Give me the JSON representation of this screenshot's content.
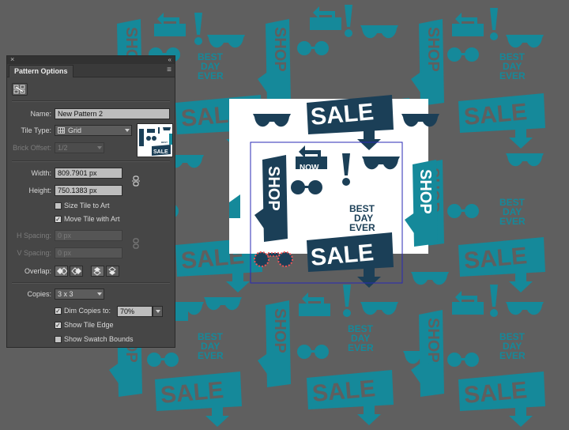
{
  "panel": {
    "tab_label": "Pattern Options",
    "close_glyph": "×",
    "collapse_glyph": "«",
    "menu_glyph": "≡",
    "name_label": "Name:",
    "name_value": "New Pattern 2",
    "tile_type_label": "Tile Type:",
    "tile_type_value": "Grid",
    "brick_offset_label": "Brick Offset:",
    "brick_offset_value": "1/2",
    "width_label": "Width:",
    "width_value": "809.7901 px",
    "height_label": "Height:",
    "height_value": "750.1383 px",
    "size_tile_to_art": {
      "label": "Size Tile to Art",
      "checked": false
    },
    "move_tile_with_art": {
      "label": "Move Tile with Art",
      "checked": true
    },
    "h_spacing_label": "H Spacing:",
    "h_spacing_value": "0 px",
    "v_spacing_label": "V Spacing:",
    "v_spacing_value": "0 px",
    "overlap_label": "Overlap:",
    "copies_label": "Copies:",
    "copies_value": "3 x 3",
    "dim_copies": {
      "label": "Dim Copies to:",
      "checked": true,
      "value": "70%"
    },
    "show_tile_edge": {
      "label": "Show Tile Edge",
      "checked": true
    },
    "show_swatch_bounds": {
      "label": "Show Swatch Bounds",
      "checked": false
    },
    "check_glyph": "✓"
  },
  "art": {
    "sale": "SALE",
    "shop": "SHOP",
    "now": "NOW",
    "best": "BEST",
    "day": "DAY",
    "ever": "EVER",
    "exclaim": "!"
  },
  "colors": {
    "teal": "#15899a",
    "navy": "#1b3f57",
    "canvas_bg": "#5f5f5f",
    "tile_bg": "#ffffff",
    "tile_edge": "#2a2ab5",
    "selection": "#ef5454"
  }
}
